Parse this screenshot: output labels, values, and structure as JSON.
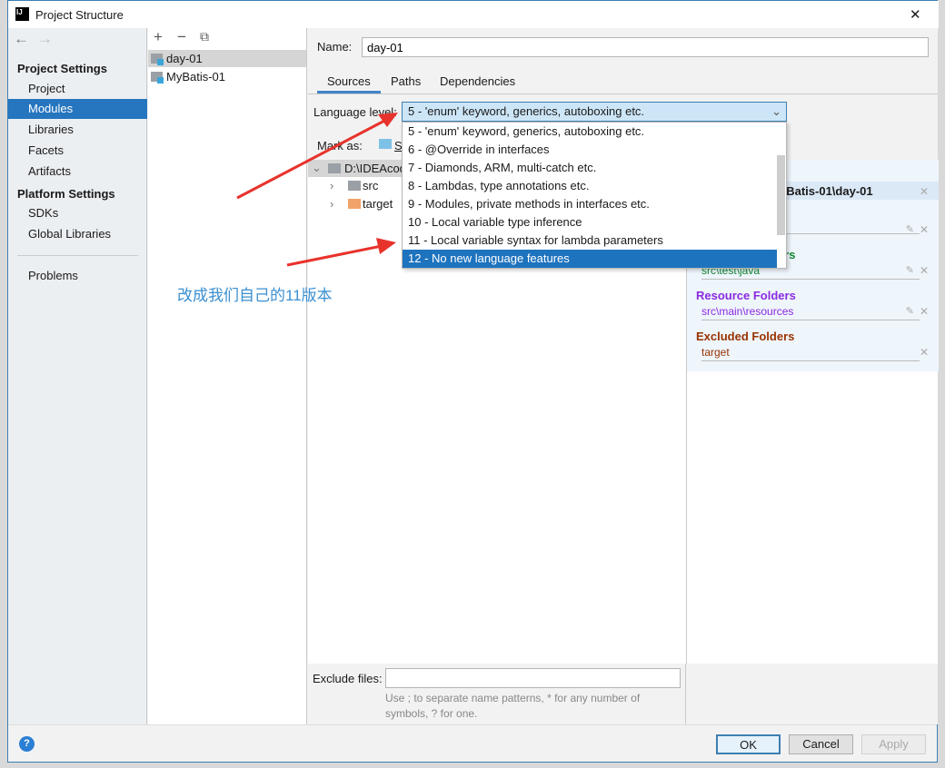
{
  "window": {
    "title": "Project Structure",
    "close": "✕"
  },
  "nav": {
    "back": "←",
    "forward": "→"
  },
  "sidebar": {
    "project_settings": "Project Settings",
    "platform_settings": "Platform Settings",
    "items": [
      {
        "label": "Project"
      },
      {
        "label": "Modules",
        "selected": true
      },
      {
        "label": "Libraries"
      },
      {
        "label": "Facets"
      },
      {
        "label": "Artifacts"
      }
    ],
    "platform_items": [
      {
        "label": "SDKs"
      },
      {
        "label": "Global Libraries"
      }
    ],
    "problems": "Problems"
  },
  "modules": {
    "toolbar": {
      "add": "+",
      "remove": "−",
      "copy": "⧉"
    },
    "items": [
      {
        "label": "day-01",
        "selected": true
      },
      {
        "label": "MyBatis-01"
      }
    ]
  },
  "main": {
    "name_label": "Name:",
    "name_value": "day-01",
    "tabs": [
      {
        "label": "Sources",
        "active": true
      },
      {
        "label": "Paths"
      },
      {
        "label": "Dependencies"
      }
    ],
    "language_level_label": "Language level:",
    "language_level_value": "5 - 'enum' keyword, generics, autoboxing etc.",
    "language_level_options": [
      "5 - 'enum' keyword, generics, autoboxing etc.",
      "6 - @Override in interfaces",
      "7 - Diamonds, ARM, multi-catch etc.",
      "8 - Lambdas, type annotations etc.",
      "9 - Modules, private methods in interfaces etc.",
      "10 - Local variable type inference",
      "11 - Local variable syntax for lambda parameters",
      "12 - No new language features"
    ],
    "highlighted_option": "12 - No new language features",
    "mark_as_label": "Mark as:",
    "mark_as_partial": "S",
    "tree": [
      {
        "label": "D:\\IDEAcod",
        "expanded": true
      },
      {
        "label": "src"
      },
      {
        "label": "target"
      }
    ],
    "roots": {
      "add_root_partial": "oot",
      "root_path_partial": "yBatis-01\\day-01",
      "test_header_partial": "ers",
      "test_path": "src\\test\\java",
      "resource_header": "Resource Folders",
      "resource_path": "src\\main\\resources",
      "excluded_header": "Excluded Folders",
      "excluded_path": "target"
    },
    "exclude_files_label": "Exclude files:",
    "exclude_files_value": "",
    "exclude_hint": "Use ; to separate name patterns, * for any number of symbols, ? for one."
  },
  "annotation": {
    "text": "改成我们自己的11版本",
    "color": "#3b8fd0"
  },
  "footer": {
    "ok": "OK",
    "cancel": "Cancel",
    "apply": "Apply",
    "help": "?"
  },
  "colors": {
    "accent": "#2675bf",
    "test": "#118833",
    "resource": "#8a2be2",
    "excluded": "#993300"
  }
}
